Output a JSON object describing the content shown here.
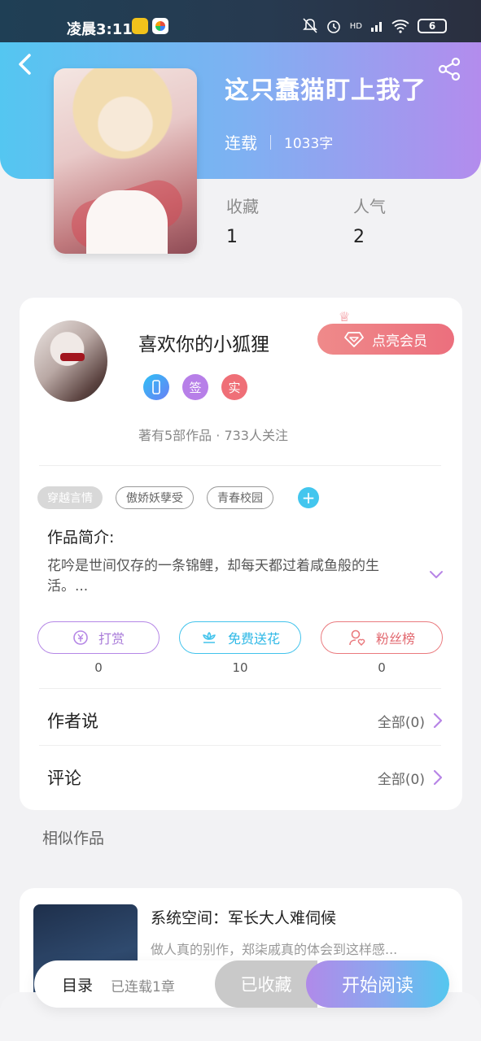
{
  "status_bar": {
    "time": "凌晨3:11",
    "battery": "6",
    "network": "HD"
  },
  "header": {
    "title": "这只蠢猫盯上我了",
    "status": "连载",
    "word_count": "1033字"
  },
  "stats": [
    {
      "label": "收藏",
      "value": "1"
    },
    {
      "label": "人气",
      "value": "2"
    }
  ],
  "author": {
    "name": "喜欢你的小狐狸",
    "vip_button": "点亮会员",
    "badges": [
      "",
      "签",
      "实"
    ],
    "works_info": "著有5部作品 · 733人关注"
  },
  "tags": [
    "穿越言情",
    "傲娇妖孽受",
    "青春校园"
  ],
  "intro": {
    "heading": "作品简介:",
    "text": "花吟是世间仅存的一条锦鲤，却每天都过着咸鱼般的生活。..."
  },
  "actions": [
    {
      "label": "打赏",
      "count": "0",
      "icon": "coin-icon"
    },
    {
      "label": "免费送花",
      "count": "10",
      "icon": "flower-icon"
    },
    {
      "label": "粉丝榜",
      "count": "0",
      "icon": "fan-icon"
    }
  ],
  "rows": [
    {
      "label": "作者说",
      "value": "全部(0)"
    },
    {
      "label": "评论",
      "value": "全部(0)"
    }
  ],
  "similar": {
    "heading": "相似作品",
    "items": [
      {
        "title": "系统空间：军长大人难伺候",
        "desc": "做人真的别作，郑柒戚真的体会到这样感..."
      }
    ]
  },
  "bottom_bar": {
    "toc_label": "目录",
    "chapter_info": "已连载1章",
    "fav_button": "已收藏",
    "read_button": "开始阅读"
  },
  "colors": {
    "header_start": "#54c6f1",
    "header_end": "#b38ced",
    "vip": "#ec6f7d",
    "accent_purple": "#b587e6",
    "accent_blue": "#42c3ec",
    "accent_red": "#ea7a7e"
  }
}
